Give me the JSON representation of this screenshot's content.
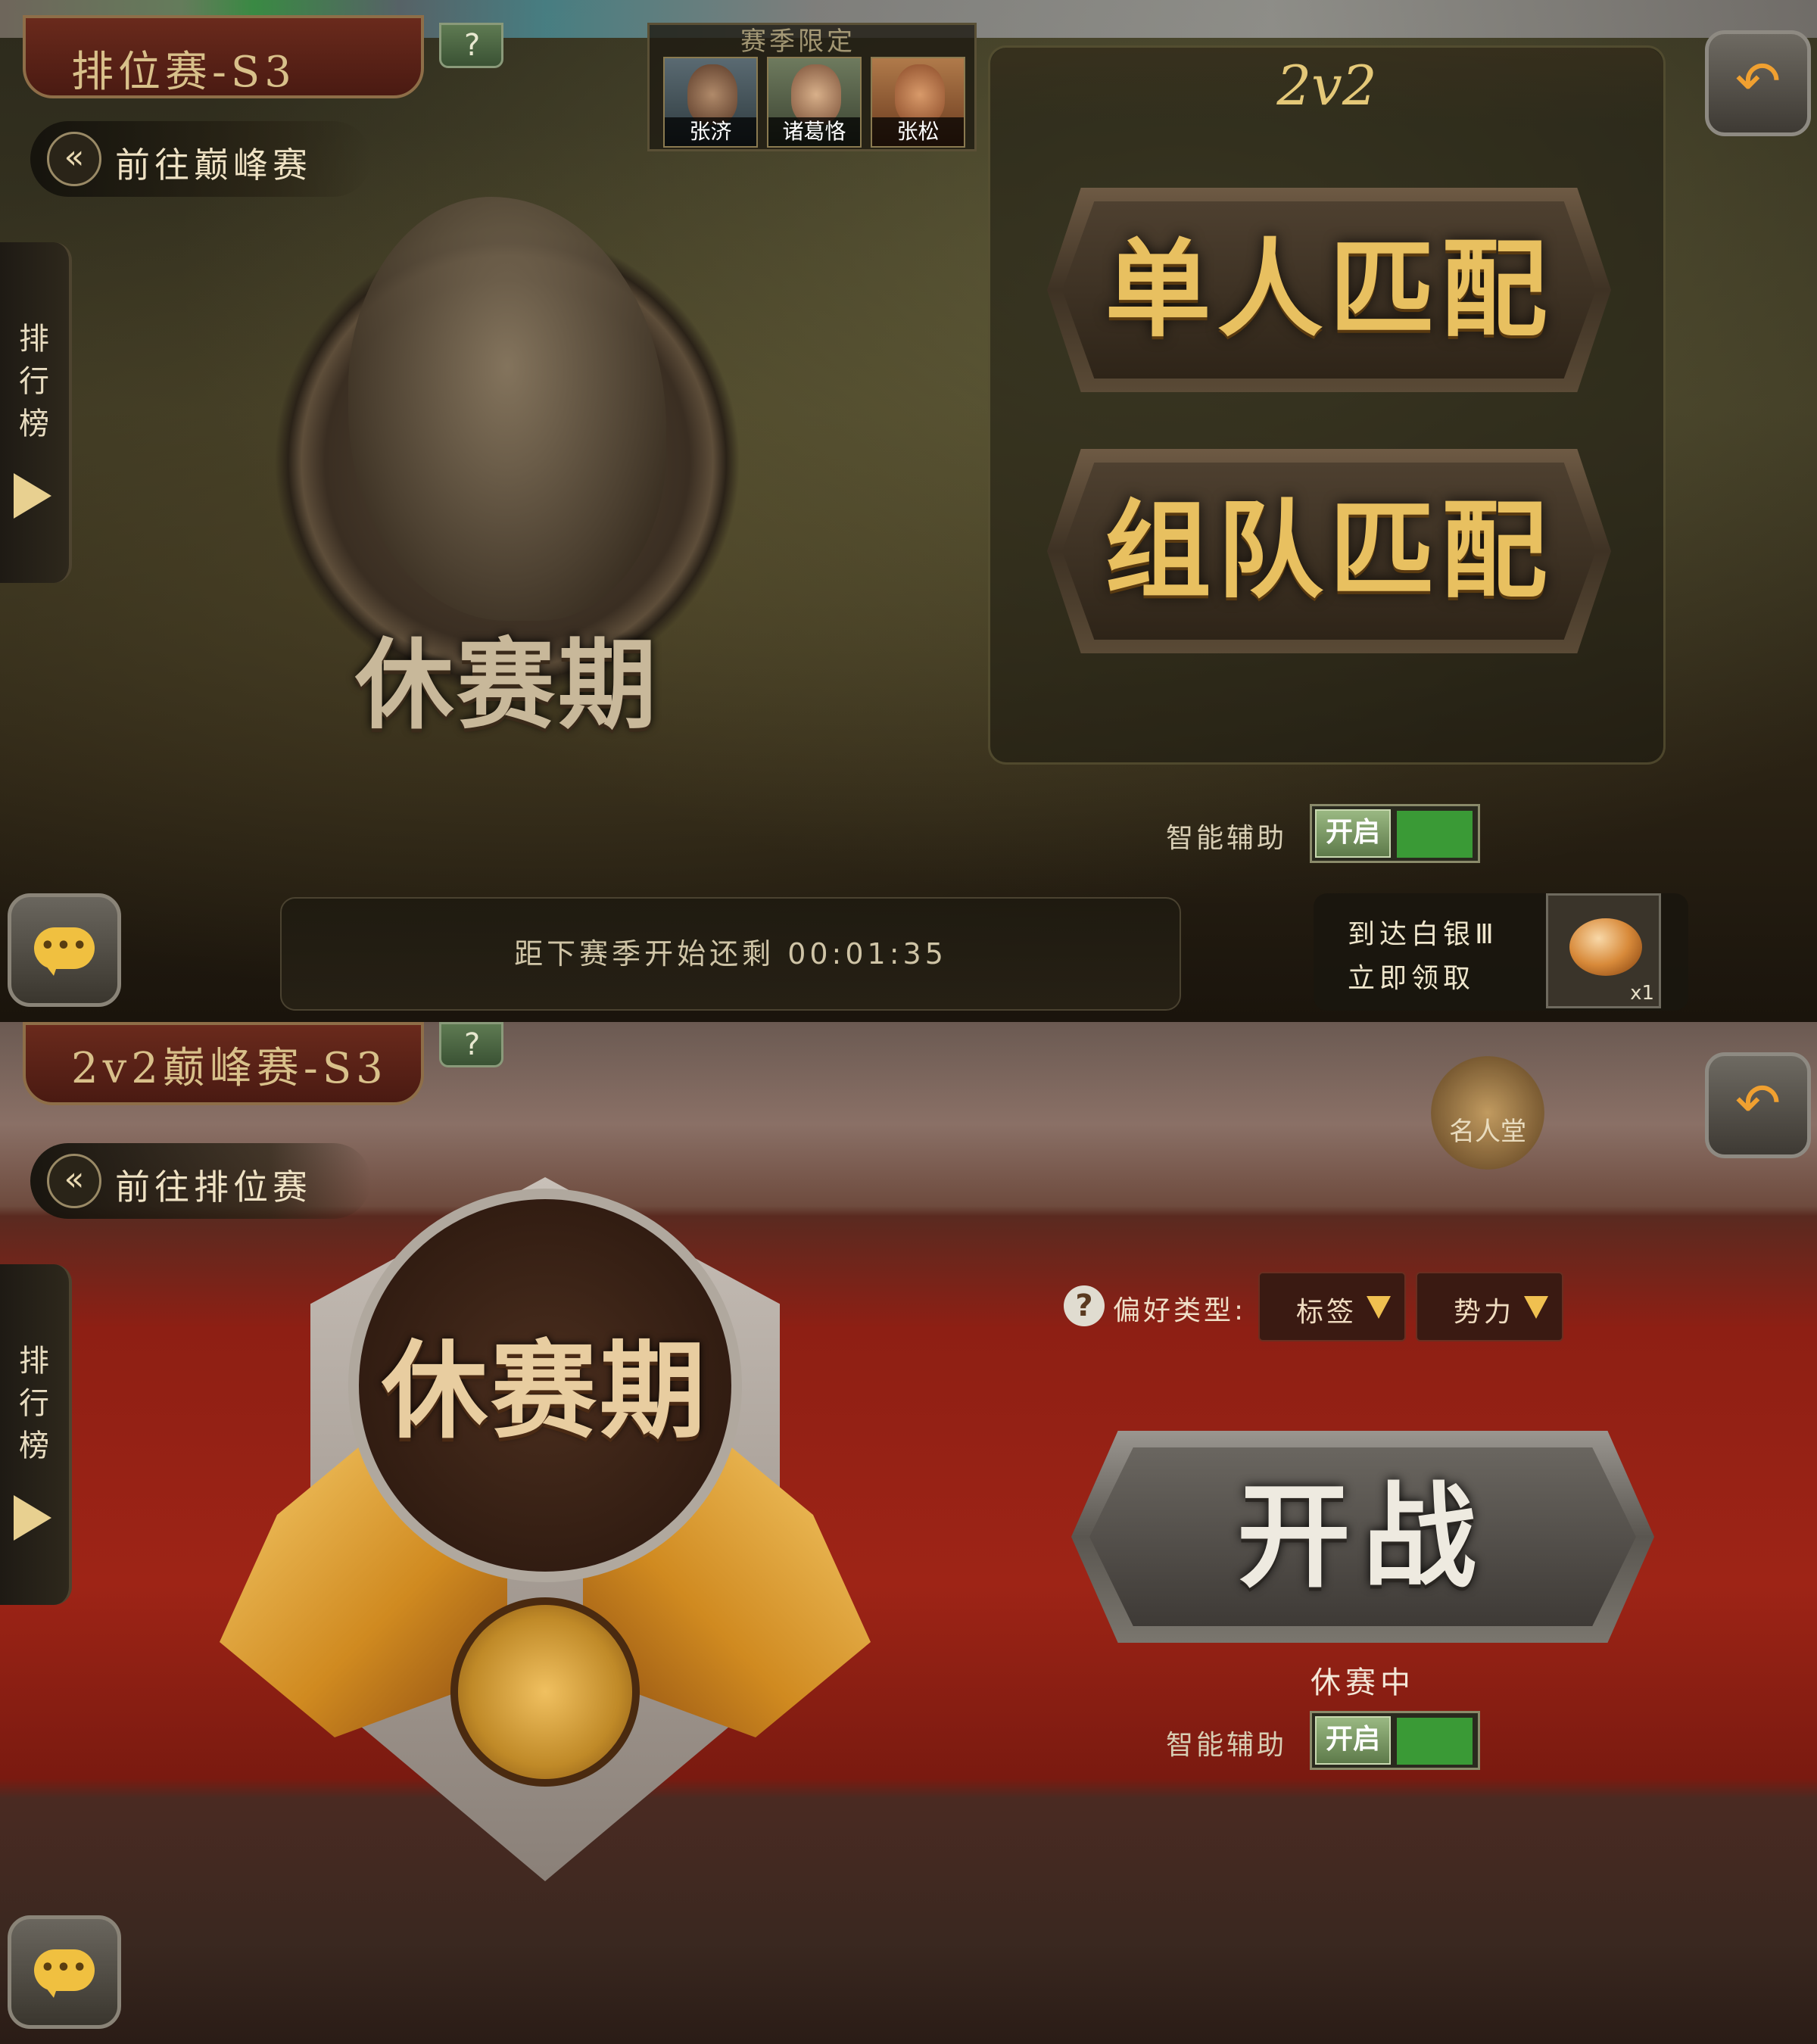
{
  "top_screen": {
    "season_title": "排位赛-S3",
    "help_label": "?",
    "nav_back_label": "前往巅峰赛",
    "leaderboard_label": "排行榜",
    "featured_heroes_header": "赛季限定",
    "heroes": [
      {
        "name": "张济"
      },
      {
        "name": "诸葛恪"
      },
      {
        "name": "张松"
      }
    ],
    "mode_title": "2v2",
    "solo_match_label": "单人匹配",
    "team_match_label": "组队匹配",
    "emblem_label": "休赛期",
    "smart_assist_label": "智能辅助",
    "smart_assist_state": "开启",
    "countdown_text": "距下赛季开始还剩  00:01:35",
    "reward_line1": "到达白银Ⅲ",
    "reward_line2": "立即领取",
    "reward_qty": "x1"
  },
  "bottom_screen": {
    "season_title": "2v2巅峰赛-S3",
    "help_label": "?",
    "nav_back_label": "前往排位赛",
    "leaderboard_label": "排行榜",
    "hall_of_fame_label": "名人堂",
    "emblem_label": "休赛期",
    "preference_label": "偏好类型:",
    "preference_help": "?",
    "filter_tag_label": "标签",
    "filter_faction_label": "势力",
    "fight_label": "开战",
    "status_text": "休赛中",
    "smart_assist_label": "智能辅助",
    "smart_assist_state": "开启"
  },
  "icons": {
    "back": "undo-arrow-icon",
    "chat": "chat-bubble-icon",
    "nav": "double-chevron-left-icon",
    "leaderboard_arrow": "play-triangle-icon",
    "dropdown": "triangle-down-icon"
  },
  "colors": {
    "accent_gold": "#e8c060",
    "toggle_on": "#3a9a36",
    "bottom_red": "#9e2416"
  }
}
